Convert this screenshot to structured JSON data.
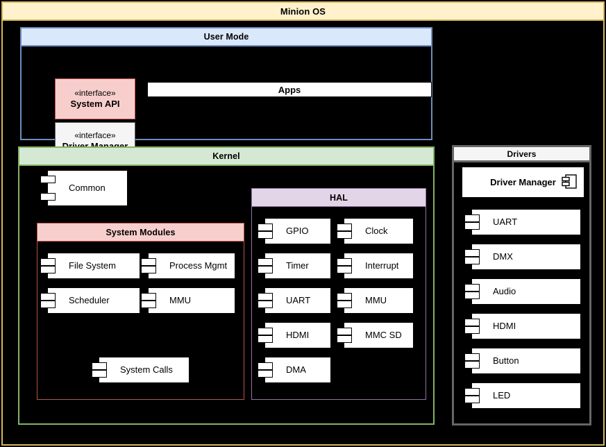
{
  "diagram": {
    "title": "Minion OS",
    "colors": {
      "frame_border": "#d6b656",
      "frame_fill": "#fff2cc",
      "user_mode_border": "#6c8ebf",
      "user_mode_fill": "#dae8fc",
      "kernel_border": "#82b366",
      "kernel_fill": "#d5e8d4",
      "system_modules_border": "#b85450",
      "system_modules_fill": "#f8cecc",
      "hal_border": "#9673a6",
      "hal_fill": "#e1d5e7",
      "drivers_border": "#666666",
      "drivers_fill": "#f5f5f5",
      "canvas": "#000000",
      "component_fill": "#ffffff"
    }
  },
  "user_mode": {
    "title": "User Mode",
    "system_api": {
      "stereotype": "«interface»",
      "name": "System API"
    },
    "driver_manager": {
      "stereotype": "«interface»",
      "name": "Driver Manager"
    },
    "apps": {
      "label": "Apps"
    }
  },
  "kernel": {
    "title": "Kernel",
    "common": {
      "label": "Common"
    },
    "system_modules": {
      "title": "System Modules",
      "components": [
        {
          "label": "File System"
        },
        {
          "label": "Process Mgmt"
        },
        {
          "label": "Scheduler"
        },
        {
          "label": "MMU"
        },
        {
          "label": "System Calls"
        }
      ]
    },
    "hal": {
      "title": "HAL",
      "components": [
        {
          "label": "GPIO"
        },
        {
          "label": "Clock"
        },
        {
          "label": "Timer"
        },
        {
          "label": "Interrupt"
        },
        {
          "label": "UART"
        },
        {
          "label": "MMU"
        },
        {
          "label": "HDMI"
        },
        {
          "label": "MMC SD"
        },
        {
          "label": "DMA"
        }
      ]
    }
  },
  "drivers": {
    "title": "Drivers",
    "manager": {
      "label": "Driver Manager",
      "icon": "uml-component-icon"
    },
    "components": [
      {
        "label": "UART"
      },
      {
        "label": "DMX"
      },
      {
        "label": "Audio"
      },
      {
        "label": "HDMI"
      },
      {
        "label": "Button"
      },
      {
        "label": "LED"
      }
    ]
  }
}
